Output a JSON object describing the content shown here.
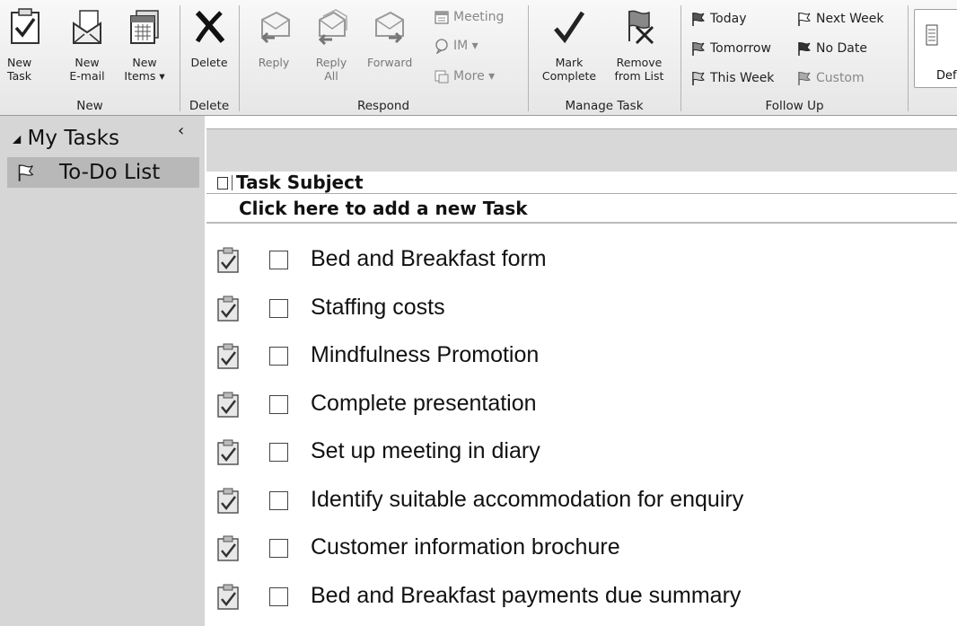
{
  "ribbon": {
    "new_group": {
      "label": "New",
      "new_task": "New\nTask",
      "new_email": "New\nE-mail",
      "new_items": "New\nItems ▾"
    },
    "delete_group": {
      "label": "Delete",
      "delete": "Delete"
    },
    "respond_group": {
      "label": "Respond",
      "reply": "Reply",
      "reply_all": "Reply\nAll",
      "forward": "Forward",
      "meeting": "Meeting",
      "im": "IM ▾",
      "more": "More ▾"
    },
    "manage_group": {
      "label": "Manage Task",
      "mark_complete": "Mark\nComplete",
      "remove_from_list": "Remove\nfrom List"
    },
    "followup_group": {
      "label": "Follow Up",
      "today": "Today",
      "next_week": "Next Week",
      "tomorrow": "Tomorrow",
      "no_date": "No Date",
      "this_week": "This Week",
      "custom": "Custom"
    },
    "default_partial": "Def"
  },
  "nav": {
    "title": "My Tasks",
    "collapse_glyph": "‹",
    "todo_label": "To-Do List"
  },
  "list": {
    "column_header": "Task Subject",
    "new_task_prompt": "Click here to add a new Task",
    "tasks": [
      {
        "title": "Bed and Breakfast form"
      },
      {
        "title": "Staffing costs"
      },
      {
        "title": "Mindfulness Promotion"
      },
      {
        "title": "Complete presentation"
      },
      {
        "title": "Set up meeting in diary"
      },
      {
        "title": "Identify suitable accommodation for enquiry"
      },
      {
        "title": "Customer information brochure"
      },
      {
        "title": "Bed and Breakfast payments due summary"
      }
    ]
  },
  "icons": {
    "new_task": "clipboard-check-icon",
    "new_email": "envelope-doc-icon",
    "new_items": "calendar-stack-icon",
    "delete": "x-icon",
    "reply": "reply-envelope-icon",
    "reply_all": "reply-all-envelope-icon",
    "forward": "forward-envelope-icon",
    "mark_complete": "checkmark-icon",
    "remove_from_list": "flag-x-icon",
    "flag": "flag-icon",
    "task": "task-clipboard-icon"
  }
}
